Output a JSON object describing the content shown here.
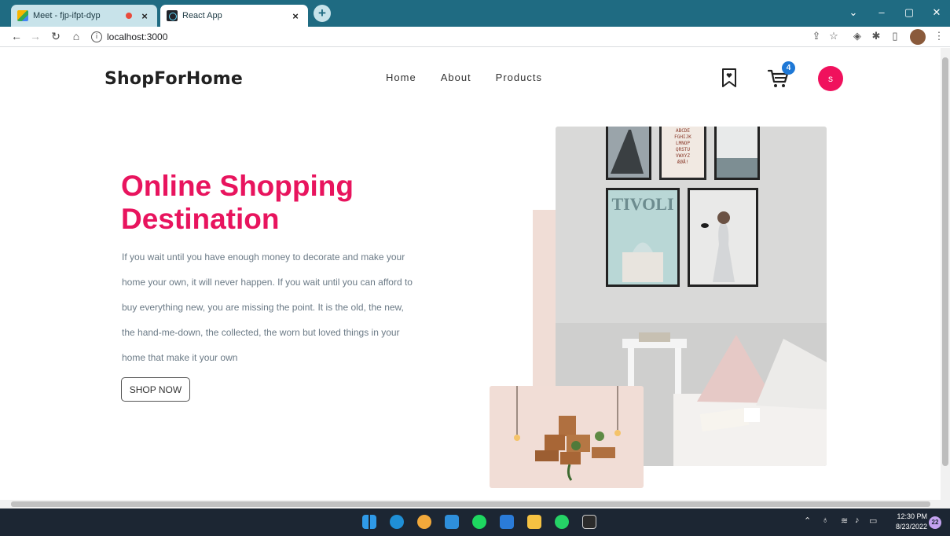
{
  "browser": {
    "tabs": [
      {
        "title": "Meet - fjp-ifpt-dyp",
        "favicon": "google-meet-icon",
        "recording": true
      },
      {
        "title": "React App",
        "favicon": "react-icon",
        "active": true
      }
    ],
    "address": "localhost:3000",
    "window_controls": {
      "minimize": "–",
      "maximize": "▢",
      "close": "✕",
      "tab_search": "⌄"
    }
  },
  "header": {
    "brand": "ShopForHome",
    "nav": [
      {
        "label": "Home"
      },
      {
        "label": "About"
      },
      {
        "label": "Products"
      }
    ],
    "wishlist_icon": "bookmark-heart-icon",
    "cart_icon": "cart-icon",
    "cart_count": "4",
    "avatar_letter": "s",
    "accent_color": "#e8145e",
    "badge_color": "#1e78d6"
  },
  "hero": {
    "title_line1": "Online Shopping",
    "title_line2": "Destination",
    "text": "If you wait until you have enough money to decorate and make your home your own, it will never happen. If you wait until you can afford to buy everything new, you are missing the point. It is the old, the new, the hand-me-down, the collected, the worn but loved things in your home that make it your own",
    "button": "SHOP NOW",
    "poster_text": "TIVOLI",
    "alphabet_poster": "ABCDE FGHIJK LMNOP QRSTU VWXYZ ÆØÅ!"
  },
  "taskbar": {
    "apps": [
      "windows-start-icon",
      "edge-icon",
      "chrome-icon",
      "vscode-icon",
      "spotify-icon",
      "mail-icon",
      "file-explorer-icon",
      "whatsapp-icon",
      "terminal-icon"
    ],
    "time": "12:30 PM",
    "date": "8/23/2022",
    "notifications": "22"
  }
}
